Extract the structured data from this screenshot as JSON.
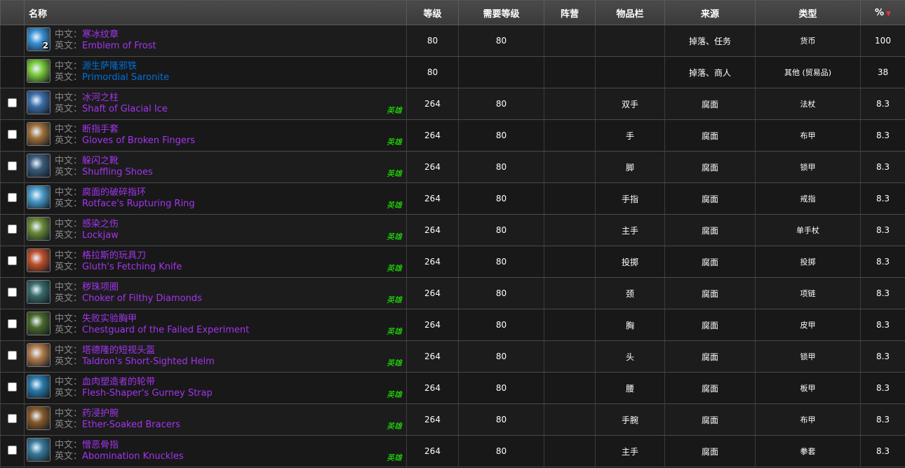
{
  "columns": {
    "name": "名称",
    "level": "等级",
    "req_level": "需要等级",
    "faction": "阵营",
    "slot": "物品栏",
    "source": "来源",
    "type": "类型",
    "pct": "%"
  },
  "labels": {
    "cn": "中文：",
    "en": "英文："
  },
  "rows": [
    {
      "cn": "寒冰纹章",
      "en": "Emblem of Frost",
      "quality": "epic",
      "count": "2",
      "heroic": "",
      "level": "80",
      "req": "80",
      "faction": "",
      "slot": "",
      "source": "掉落、任务",
      "type": "货币",
      "pct": "100",
      "icon": "emblem-icon",
      "color": "#3a8fd0",
      "checkbox": false
    },
    {
      "cn": "源生萨隆邪铁",
      "en": "Primordial Saronite",
      "quality": "rare",
      "count": "",
      "heroic": "",
      "level": "80",
      "req": "",
      "faction": "",
      "slot": "",
      "source": "掉落、商人",
      "type": "其他 (贸易品)",
      "pct": "38",
      "icon": "saronite-icon",
      "color": "#7ac83a",
      "checkbox": false
    },
    {
      "cn": "冰河之柱",
      "en": "Shaft of Glacial Ice",
      "quality": "epic",
      "count": "",
      "heroic": "英雄",
      "level": "264",
      "req": "80",
      "faction": "",
      "slot": "双手",
      "source": "腐面",
      "type": "法杖",
      "pct": "8.3",
      "icon": "staff-icon",
      "color": "#3d6ea8",
      "checkbox": true
    },
    {
      "cn": "断指手套",
      "en": "Gloves of Broken Fingers",
      "quality": "epic",
      "count": "",
      "heroic": "英雄",
      "level": "264",
      "req": "80",
      "faction": "",
      "slot": "手",
      "source": "腐面",
      "type": "布甲",
      "pct": "8.3",
      "icon": "gloves-icon",
      "color": "#a0703a",
      "checkbox": true
    },
    {
      "cn": "躲闪之靴",
      "en": "Shuffling Shoes",
      "quality": "epic",
      "count": "",
      "heroic": "英雄",
      "level": "264",
      "req": "80",
      "faction": "",
      "slot": "脚",
      "source": "腐面",
      "type": "锁甲",
      "pct": "8.3",
      "icon": "boots-icon",
      "color": "#3b5b7a",
      "checkbox": true
    },
    {
      "cn": "腐面的破碎指环",
      "en": "Rotface's Rupturing Ring",
      "quality": "epic",
      "count": "",
      "heroic": "英雄",
      "level": "264",
      "req": "80",
      "faction": "",
      "slot": "手指",
      "source": "腐面",
      "type": "戒指",
      "pct": "8.3",
      "icon": "ring-icon",
      "color": "#4a9bc8",
      "checkbox": true
    },
    {
      "cn": "感染之伤",
      "en": "Lockjaw",
      "quality": "epic",
      "count": "",
      "heroic": "英雄",
      "level": "264",
      "req": "80",
      "faction": "",
      "slot": "主手",
      "source": "腐面",
      "type": "单手杖",
      "pct": "8.3",
      "icon": "mace-icon",
      "color": "#6a8a3a",
      "checkbox": true
    },
    {
      "cn": "格拉斯的玩具刀",
      "en": "Gluth's Fetching Knife",
      "quality": "epic",
      "count": "",
      "heroic": "英雄",
      "level": "264",
      "req": "80",
      "faction": "",
      "slot": "投掷",
      "source": "腐面",
      "type": "投掷",
      "pct": "8.3",
      "icon": "knife-icon",
      "color": "#c0502a",
      "checkbox": true
    },
    {
      "cn": "秽珠项圈",
      "en": "Choker of Filthy Diamonds",
      "quality": "epic",
      "count": "",
      "heroic": "英雄",
      "level": "264",
      "req": "80",
      "faction": "",
      "slot": "颈",
      "source": "腐面",
      "type": "项链",
      "pct": "8.3",
      "icon": "necklace-icon",
      "color": "#3a6a6a",
      "checkbox": true
    },
    {
      "cn": "失败实验胸甲",
      "en": "Chestguard of the Failed Experiment",
      "quality": "epic",
      "count": "",
      "heroic": "英雄",
      "level": "264",
      "req": "80",
      "faction": "",
      "slot": "胸",
      "source": "腐面",
      "type": "皮甲",
      "pct": "8.3",
      "icon": "chest-icon",
      "color": "#4a6a2a",
      "checkbox": true
    },
    {
      "cn": "塔德隆的短视头盔",
      "en": "Taldron's Short-Sighted Helm",
      "quality": "epic",
      "count": "",
      "heroic": "英雄",
      "level": "264",
      "req": "80",
      "faction": "",
      "slot": "头",
      "source": "腐面",
      "type": "锁甲",
      "pct": "8.3",
      "icon": "helm-icon",
      "color": "#b07a4a",
      "checkbox": true
    },
    {
      "cn": "血肉塑造者的轮带",
      "en": "Flesh-Shaper's Gurney Strap",
      "quality": "epic",
      "count": "",
      "heroic": "英雄",
      "level": "264",
      "req": "80",
      "faction": "",
      "slot": "腰",
      "source": "腐面",
      "type": "板甲",
      "pct": "8.3",
      "icon": "belt-icon",
      "color": "#2a7aa8",
      "checkbox": true
    },
    {
      "cn": "药浸护腕",
      "en": "Ether-Soaked Bracers",
      "quality": "epic",
      "count": "",
      "heroic": "英雄",
      "level": "264",
      "req": "80",
      "faction": "",
      "slot": "手腕",
      "source": "腐面",
      "type": "布甲",
      "pct": "8.3",
      "icon": "bracers-icon",
      "color": "#8a5a2a",
      "checkbox": true
    },
    {
      "cn": "憎恶骨指",
      "en": "Abomination Knuckles",
      "quality": "epic",
      "count": "",
      "heroic": "英雄",
      "level": "264",
      "req": "80",
      "faction": "",
      "slot": "主手",
      "source": "腐面",
      "type": "拳套",
      "pct": "8.3",
      "icon": "knuckles-icon",
      "color": "#3a7a9a",
      "checkbox": true
    }
  ]
}
